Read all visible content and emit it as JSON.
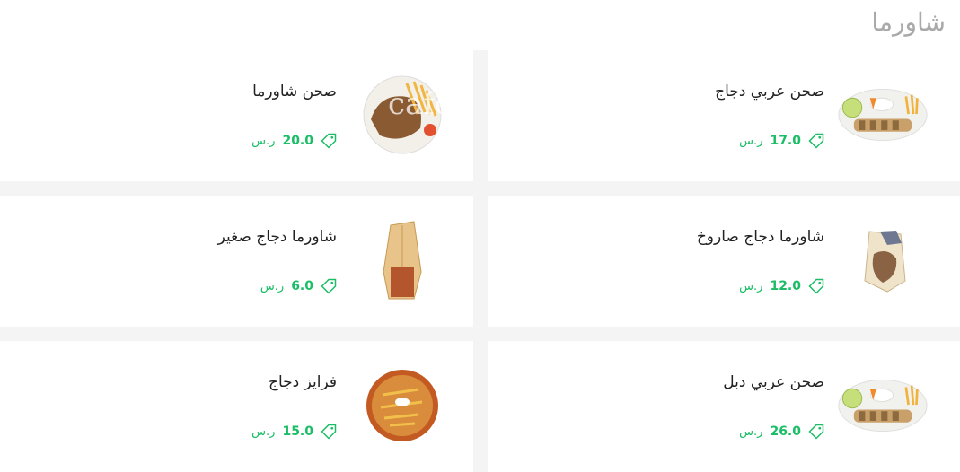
{
  "section": {
    "title": "شاورما"
  },
  "watermark": "cafe",
  "items": [
    {
      "name": "صحن عربي دجاج",
      "price": "17.0",
      "currency": "ر.س",
      "image": "platter-chicken"
    },
    {
      "name": "صحن شاورما",
      "price": "20.0",
      "currency": "ر.س",
      "image": "shawarma-plate"
    },
    {
      "name": "شاورما دجاج صاروخ",
      "price": "12.0",
      "currency": "ر.س",
      "image": "wrap-saroukh"
    },
    {
      "name": "شاورما دجاج صغير",
      "price": "6.0",
      "currency": "ر.س",
      "image": "wrap-small"
    },
    {
      "name": "صحن عربي دبل",
      "price": "26.0",
      "currency": "ر.س",
      "image": "platter-double"
    },
    {
      "name": "فرايز دجاج",
      "price": "15.0",
      "currency": "ر.س",
      "image": "fries-chicken"
    }
  ],
  "colors": {
    "price": "#1bbd66",
    "title": "#a9a9a9"
  }
}
